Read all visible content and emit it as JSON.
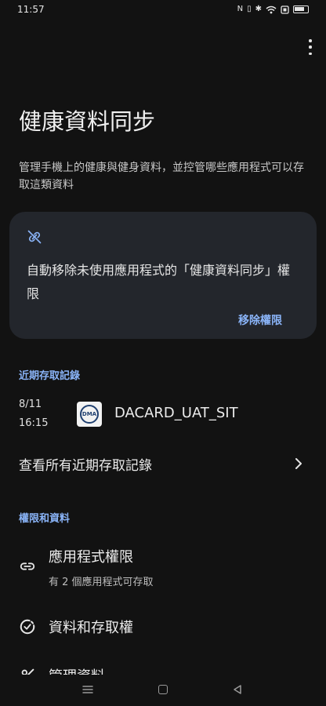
{
  "status_bar": {
    "time": "11:57",
    "icons": [
      "nfc-icon",
      "vibrate-icon",
      "bluetooth-icon",
      "wifi-icon",
      "sim-icon",
      "battery-icon"
    ]
  },
  "header": {
    "title": "健康資料同步",
    "description": "管理手機上的健康與健身資料，並控管哪些應用程式可以存取這類資料"
  },
  "card": {
    "icon": "link-off-icon",
    "text": "自動移除未使用應用程式的「健康資料同步」權限",
    "action_label": "移除權限"
  },
  "recent_access": {
    "section_title": "近期存取記錄",
    "entries": [
      {
        "date": "8/11",
        "time": "16:15",
        "app_name": "DACARD_UAT_SIT",
        "icon_text": "DMA"
      }
    ],
    "view_all_label": "查看所有近期存取記錄"
  },
  "permissions": {
    "section_title": "權限和資料",
    "items": [
      {
        "icon": "link-icon",
        "title": "應用程式權限",
        "subtitle": "有 2 個應用程式可存取"
      },
      {
        "icon": "data-access-icon",
        "title": "資料和存取權"
      },
      {
        "icon": "manage-data-icon",
        "title": "管理資料"
      }
    ]
  },
  "colors": {
    "background": "#121212",
    "card": "#23262c",
    "accent": "#8ab4f8",
    "text_primary": "#ececec"
  }
}
